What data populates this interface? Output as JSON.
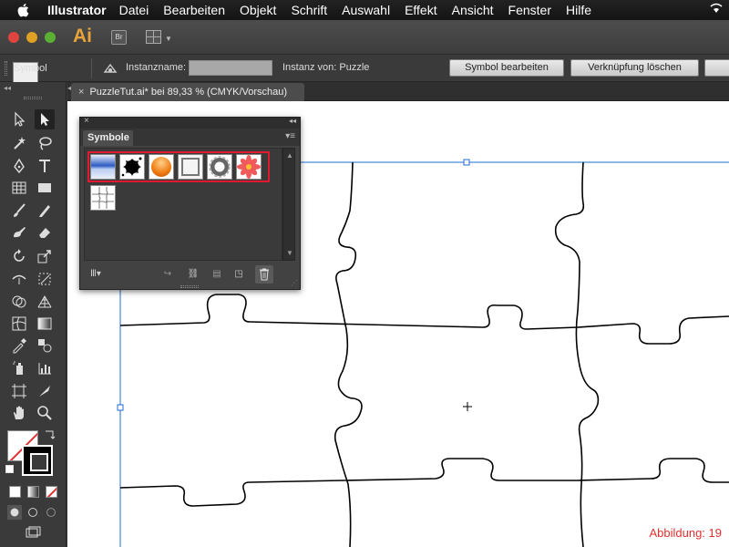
{
  "menubar": {
    "app": "Illustrator",
    "items": [
      "Datei",
      "Bearbeiten",
      "Objekt",
      "Schrift",
      "Auswahl",
      "Effekt",
      "Ansicht",
      "Fenster",
      "Hilfe"
    ]
  },
  "appbar": {
    "logo": "Ai",
    "bridge": "Br"
  },
  "controlbar": {
    "type_label": "Symbol",
    "instance_name_label": "Instanzname:",
    "instance_name_value": "",
    "instance_of_label": "Instanz von: Puzzle",
    "edit_button": "Symbol bearbeiten",
    "break_link_button": "Verknüpfung löschen"
  },
  "document": {
    "tab_title": "PuzzleTut.ai* bei 89,33 % (CMYK/Vorschau)",
    "close": "×"
  },
  "panel": {
    "tab": "Symbole",
    "symbols": [
      "blue-gradient-banner",
      "black-splat",
      "orange-glossy-button",
      "grunge-frame",
      "dark-gear-ring",
      "red-flower",
      "puzzle-grid"
    ]
  },
  "caption": "Abbildung: 19",
  "colors": {
    "highlight": "#e01830",
    "selection_blue": "#1e6fd0",
    "caption": "#e03030",
    "ai_logo": "#e8a33a"
  }
}
